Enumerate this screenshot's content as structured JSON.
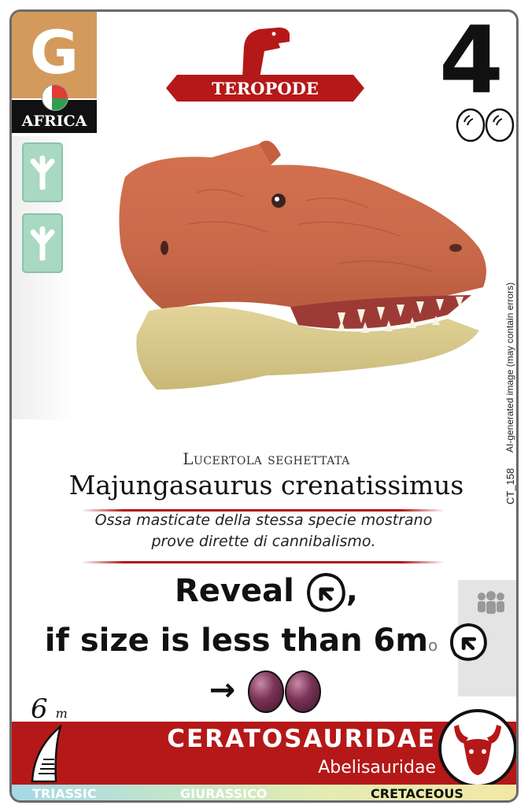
{
  "card": {
    "grade": "G",
    "region": "AFRICA",
    "type": "TEROPODE",
    "score": "4",
    "common_name": "Lucertola seghettata",
    "scientific_name": "Majungasaurus crenatissimus",
    "fact_line1": "Ossa masticate della stessa specie mostrano",
    "fact_line2": "prove dirette di cannibalismo.",
    "ability_line1_prefix": "Reveal",
    "ability_line1_suffix": ",",
    "ability_line2": "if size is less than 6m",
    "ability_line2_suffix": "o",
    "ability_arrow": "→",
    "size_value": "6",
    "size_unit": "m",
    "family": "CERATOSAURIDAE",
    "subfamily": "Abelisauridae",
    "ai_note": "AI-generated image (may contain errors)",
    "code": "CT_158",
    "eras": [
      "TRIASSIC",
      "GIURASSICO",
      "CRETACEOUS"
    ]
  },
  "colors": {
    "grade_bg": "#d39a5c",
    "family_red": "#b51818",
    "track_green": "#a9d9c3",
    "egg_purple": "#6b2a4a"
  },
  "icons": {
    "tracks": [
      "footprint-icon",
      "footprint-icon"
    ],
    "eggs_top": [
      "egg-outline-icon",
      "egg-outline-icon"
    ],
    "ability": [
      "footprint-badge-icon",
      "purple-egg-icon"
    ],
    "family_icon": "bull-head-icon",
    "claw_icon": "claw-icon",
    "herd_icon": "herd-icon"
  }
}
